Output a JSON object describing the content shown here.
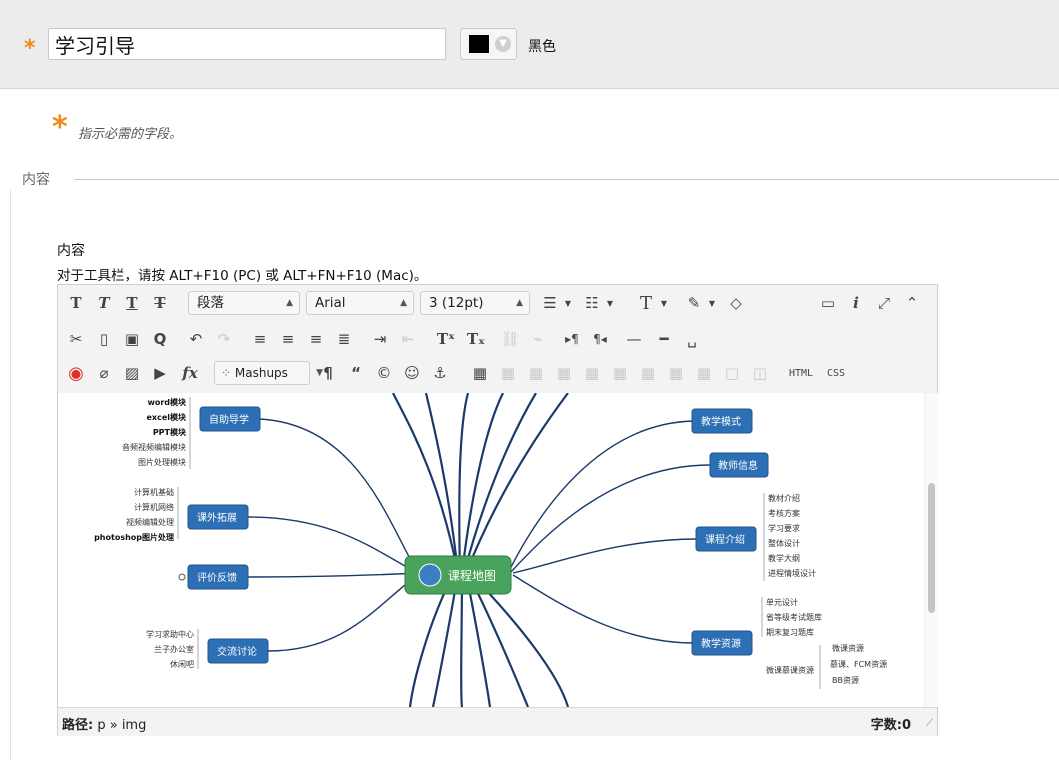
{
  "title_field": {
    "value": "学习引导"
  },
  "color": {
    "value": "#000000",
    "label": "黑色"
  },
  "required_hint": "指示必需的字段。",
  "section": {
    "legend": "内容"
  },
  "content_field": {
    "label": "内容",
    "toolbar_hint": "对于工具栏，请按 ALT+F10 (PC) 或 ALT+FN+F10 (Mac)。"
  },
  "editor": {
    "paragraph_select": "段落",
    "font_select": "Arial",
    "size_select": "3 (12pt)",
    "mashups_label": "Mashups",
    "html_label": "HTML",
    "css_label": "CSS",
    "status_path_label": "路径:",
    "status_path_value": "p » img",
    "word_count": "字数:0"
  },
  "mindmap": {
    "center": "课程地图",
    "left_nodes": [
      {
        "label": "自助导学",
        "leaves": [
          "word模块",
          "excel模块",
          "PPT模块",
          "音频视频编辑模块",
          "图片处理模块"
        ]
      },
      {
        "label": "课外拓展",
        "leaves": [
          "计算机基础",
          "计算机网络",
          "视频编辑处理",
          "photoshop图片处理"
        ]
      },
      {
        "label": "评价反馈",
        "leaves": []
      },
      {
        "label": "交流讨论",
        "leaves": [
          "学习求助中心",
          "兰子办公室",
          "休闲吧"
        ]
      }
    ],
    "right_nodes": [
      {
        "label": "教学模式",
        "leaves": []
      },
      {
        "label": "教师信息",
        "leaves": []
      },
      {
        "label": "课程介绍",
        "leaves": [
          "教材介绍",
          "考核方案",
          "学习要求",
          "整体设计",
          "教学大纲",
          "进程情境设计"
        ]
      },
      {
        "label": "教学资源",
        "leaves": [
          "单元设计",
          "省等级考试题库",
          "期末复习题库",
          "微课慕课资源"
        ]
      }
    ],
    "sub_leaves": [
      "微课资源",
      "慕课、FCM资源",
      "BB资源"
    ]
  },
  "colors": {
    "accent_orange": "#f08a1c",
    "node_blue": "#2c6fb4",
    "center_green": "#4aa35c",
    "branch": "#1b3a6b"
  }
}
